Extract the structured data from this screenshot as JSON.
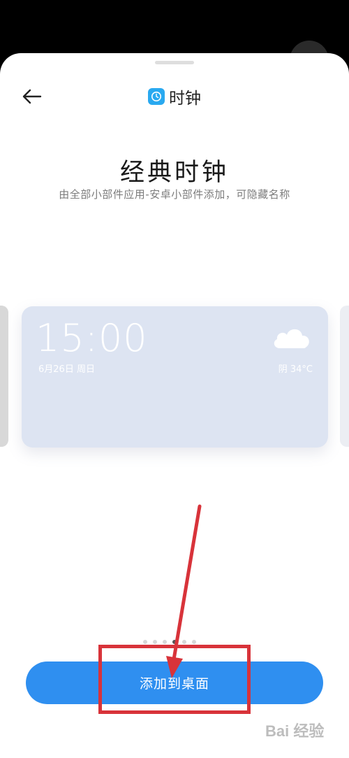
{
  "header": {
    "title": "时钟",
    "back_icon": "back-arrow-icon",
    "app_icon": "clock-icon"
  },
  "widget": {
    "title": "经典时钟",
    "subtitle": "由全部小部件应用-安卓小部件添加，可隐藏名称"
  },
  "preview": {
    "time": "15:00",
    "date": "6月26日 周日",
    "weather": "阴 34°C",
    "weather_icon": "cloud-icon"
  },
  "pager": {
    "count": 6,
    "active_index": 3
  },
  "add_button": {
    "label": "添加到桌面"
  },
  "watermark": {
    "text": "Bai 经验"
  },
  "colors": {
    "accent": "#2f8ff0",
    "annotation": "#d8333a",
    "card": "#dde4f2"
  }
}
